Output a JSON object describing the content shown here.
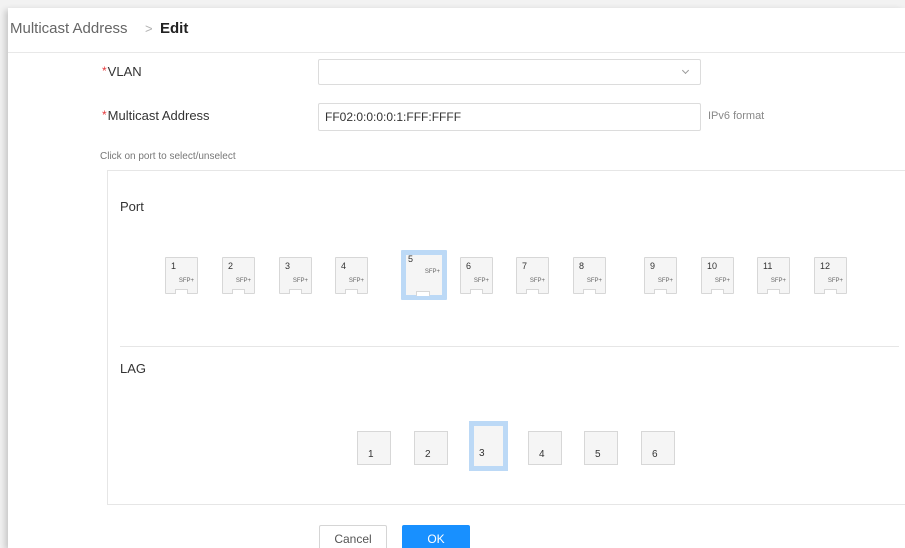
{
  "breadcrumb": {
    "root": "Multicast Address",
    "separator": ">",
    "current": "Edit"
  },
  "form": {
    "required_mark": "*",
    "vlan": {
      "label": "VLAN",
      "value": ""
    },
    "multicast_address": {
      "label": "Multicast Address",
      "value": "FF02:0:0:0:0:1:FFF:FFFF",
      "hint": "IPv6 format"
    },
    "tip": "Click on port to select/unselect"
  },
  "ports": {
    "title": "Port",
    "items": [
      {
        "number": "1",
        "type": "SFP+",
        "selected": false
      },
      {
        "number": "2",
        "type": "SFP+",
        "selected": false
      },
      {
        "number": "3",
        "type": "SFP+",
        "selected": false
      },
      {
        "number": "4",
        "type": "SFP+",
        "selected": false
      },
      {
        "number": "5",
        "type": "SFP+",
        "selected": true
      },
      {
        "number": "6",
        "type": "SFP+",
        "selected": false
      },
      {
        "number": "7",
        "type": "SFP+",
        "selected": false
      },
      {
        "number": "8",
        "type": "SFP+",
        "selected": false
      },
      {
        "number": "9",
        "type": "SFP+",
        "selected": false
      },
      {
        "number": "10",
        "type": "SFP+",
        "selected": false
      },
      {
        "number": "11",
        "type": "SFP+",
        "selected": false
      },
      {
        "number": "12",
        "type": "SFP+",
        "selected": false
      }
    ]
  },
  "lag": {
    "title": "LAG",
    "items": [
      {
        "number": "1",
        "selected": false
      },
      {
        "number": "2",
        "selected": false
      },
      {
        "number": "3",
        "selected": true
      },
      {
        "number": "4",
        "selected": false
      },
      {
        "number": "5",
        "selected": false
      },
      {
        "number": "6",
        "selected": false
      }
    ]
  },
  "buttons": {
    "cancel": "Cancel",
    "ok": "OK"
  },
  "colors": {
    "primary": "#1890ff",
    "selected_border": "#bcd9f6",
    "required": "#e4393c"
  }
}
